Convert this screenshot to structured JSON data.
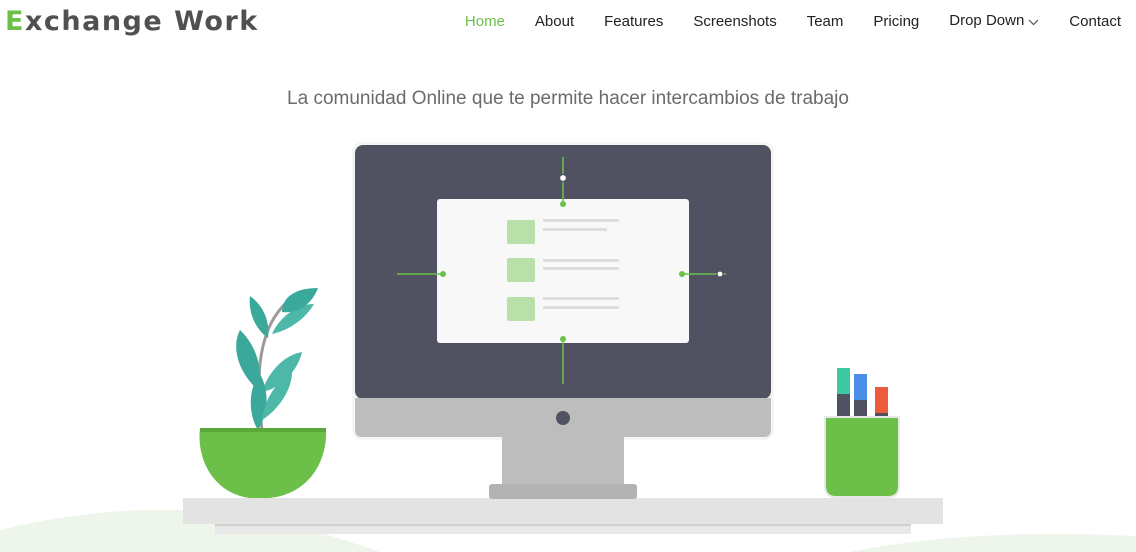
{
  "brand": {
    "first_letter": "E",
    "rest": "xchange Work"
  },
  "nav": {
    "items": [
      {
        "label": "Home",
        "active": true
      },
      {
        "label": "About"
      },
      {
        "label": "Features"
      },
      {
        "label": "Screenshots"
      },
      {
        "label": "Team"
      },
      {
        "label": "Pricing"
      },
      {
        "label": "Drop Down",
        "icon": "chevron-down-icon"
      },
      {
        "label": "Contact"
      }
    ]
  },
  "hero": {
    "tagline": "La comunidad Online que te permite hacer intercambios de trabajo"
  },
  "colors": {
    "accent": "#6cc04a",
    "monitor": "#505261",
    "text": "#6b6b6b"
  }
}
